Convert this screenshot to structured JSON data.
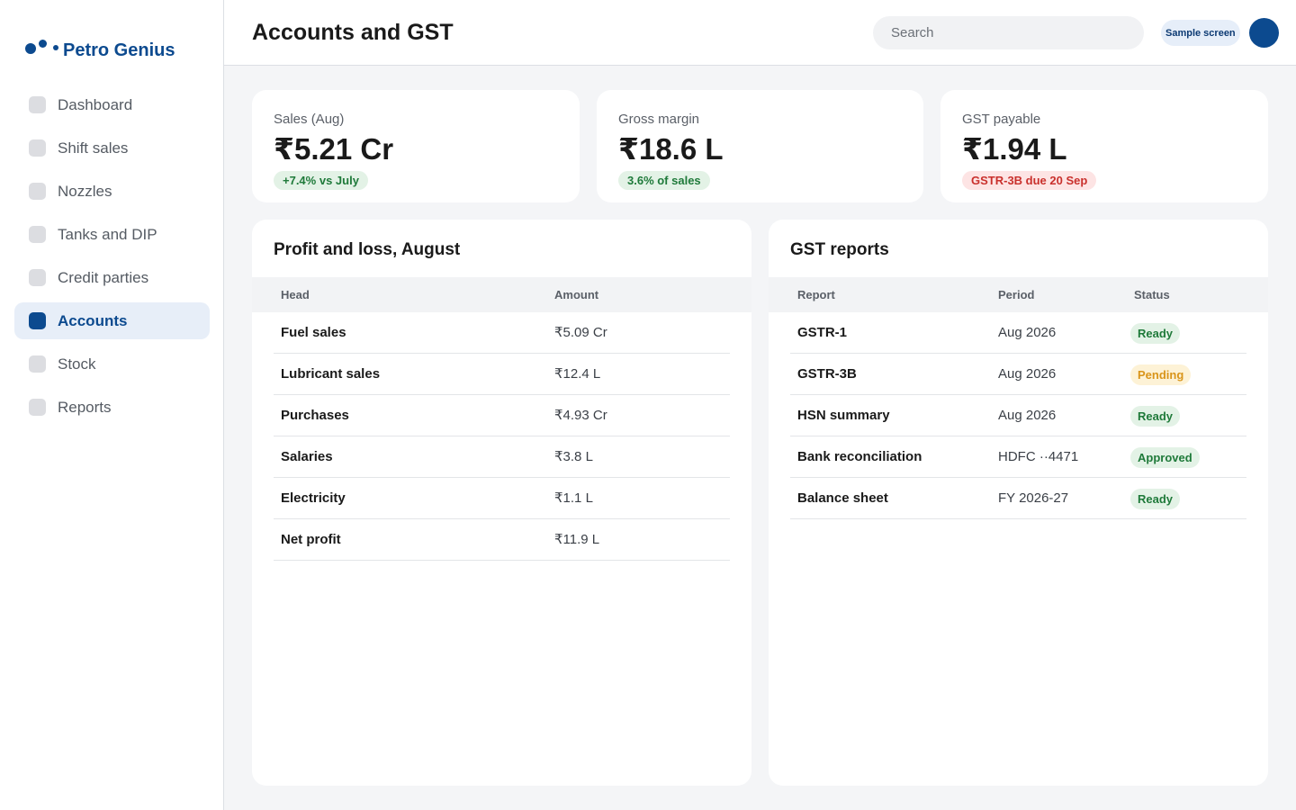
{
  "brand": {
    "name": "Petro Genius",
    "color": "#0c4a8f"
  },
  "sidebar": {
    "items": [
      {
        "label": "Dashboard",
        "active": false
      },
      {
        "label": "Shift sales",
        "active": false
      },
      {
        "label": "Nozzles",
        "active": false
      },
      {
        "label": "Tanks and DIP",
        "active": false
      },
      {
        "label": "Credit parties",
        "active": false
      },
      {
        "label": "Accounts",
        "active": true
      },
      {
        "label": "Stock",
        "active": false
      },
      {
        "label": "Reports",
        "active": false
      }
    ]
  },
  "header": {
    "title": "Accounts and GST",
    "search_placeholder": "Search",
    "badge": "Sample screen"
  },
  "kpis": [
    {
      "label": "Sales (Aug)",
      "value": "₹5.21 Cr",
      "chip": "+7.4% vs July",
      "chip_tone": "green"
    },
    {
      "label": "Gross margin",
      "value": "₹18.6 L",
      "chip": "3.6% of sales",
      "chip_tone": "green"
    },
    {
      "label": "GST payable",
      "value": "₹1.94 L",
      "chip": "GSTR-3B due 20 Sep",
      "chip_tone": "red"
    }
  ],
  "pnl": {
    "title": "Profit and loss, August",
    "columns": [
      "Head",
      "Amount"
    ],
    "rows": [
      {
        "head": "Fuel sales",
        "amount": "₹5.09 Cr"
      },
      {
        "head": "Lubricant sales",
        "amount": "₹12.4 L"
      },
      {
        "head": "Purchases",
        "amount": "₹4.93 Cr"
      },
      {
        "head": "Salaries",
        "amount": "₹3.8 L"
      },
      {
        "head": "Electricity",
        "amount": "₹1.1 L"
      },
      {
        "head": "Net profit",
        "amount": "₹11.9 L"
      }
    ]
  },
  "gst": {
    "title": "GST reports",
    "columns": [
      "Report",
      "Period",
      "Status"
    ],
    "rows": [
      {
        "report": "GSTR-1",
        "period": "Aug 2026",
        "status": "Ready",
        "tone": "ready"
      },
      {
        "report": "GSTR-3B",
        "period": "Aug 2026",
        "status": "Pending",
        "tone": "pending"
      },
      {
        "report": "HSN summary",
        "period": "Aug 2026",
        "status": "Ready",
        "tone": "ready"
      },
      {
        "report": "Bank reconciliation",
        "period": "HDFC ··4471",
        "status": "Approved",
        "tone": "approved"
      },
      {
        "report": "Balance sheet",
        "period": "FY 2026-27",
        "status": "Ready",
        "tone": "ready"
      }
    ]
  }
}
